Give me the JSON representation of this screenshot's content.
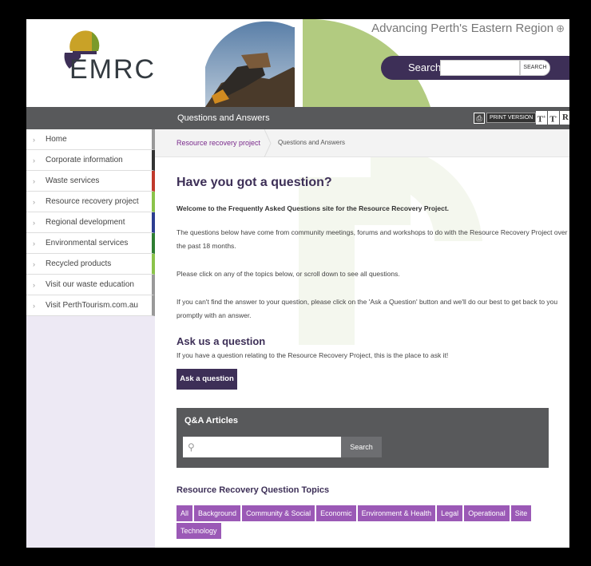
{
  "brand": {
    "logo_text": "EMRC",
    "tagline": "Advancing Perth's Eastern Region"
  },
  "header_search": {
    "label": "Search:",
    "value": "",
    "button_label": "SEARCH"
  },
  "toolbar": {
    "page_title": "Questions and Answers",
    "print_label": "PRINT VERSION",
    "font_increase": "T",
    "font_decrease": "T",
    "font_reset": "R"
  },
  "sidebar": {
    "items": [
      {
        "label": "Home",
        "accent": "#999999"
      },
      {
        "label": "Corporate information",
        "accent": "#333333"
      },
      {
        "label": "Waste services",
        "accent": "#c0392b"
      },
      {
        "label": "Resource recovery project",
        "accent": "#8bc34a"
      },
      {
        "label": "Regional development",
        "accent": "#2c3e90"
      },
      {
        "label": "Environmental services",
        "accent": "#2e7d32"
      },
      {
        "label": "Recycled products",
        "accent": "#8bc34a"
      },
      {
        "label": "Visit our waste education website",
        "accent": "#999999"
      },
      {
        "label": "Visit PerthTourism.com.au",
        "accent": "#999999"
      }
    ]
  },
  "breadcrumb": {
    "parent": "Resource recovery project",
    "current": "Questions and Answers"
  },
  "main": {
    "heading": "Have you got a question?",
    "intro": "Welcome to the Frequently Asked Questions site for the Resource Recovery Project.",
    "para1": "The questions below have come from community meetings, forums and workshops to do with the Resource Recovery Project over the past 18 months.",
    "para2": "Please click on any of the topics below, or scroll down to see all questions.",
    "para3": "If you can't find the answer to your question, please click on the 'Ask a Question' button and we'll do our best to get back to you promptly with an answer.",
    "ask_heading": "Ask us a question",
    "ask_sub": "If you have a question relating to the Resource Recovery Project, this is the place to ask it!",
    "ask_button": "Ask a question"
  },
  "qa": {
    "title": "Q&A Articles",
    "input_value": "",
    "search_button": "Search"
  },
  "topics": {
    "title": "Resource Recovery Question Topics",
    "items": [
      "All",
      "Background",
      "Community & Social",
      "Economic",
      "Environment & Health",
      "Legal",
      "Operational",
      "Site",
      "Technology"
    ]
  },
  "colors": {
    "brand_purple": "#3d2f57",
    "topic_purple": "#9b59b6",
    "dark_bar": "#58595b",
    "accent_green": "#8bc34a"
  }
}
